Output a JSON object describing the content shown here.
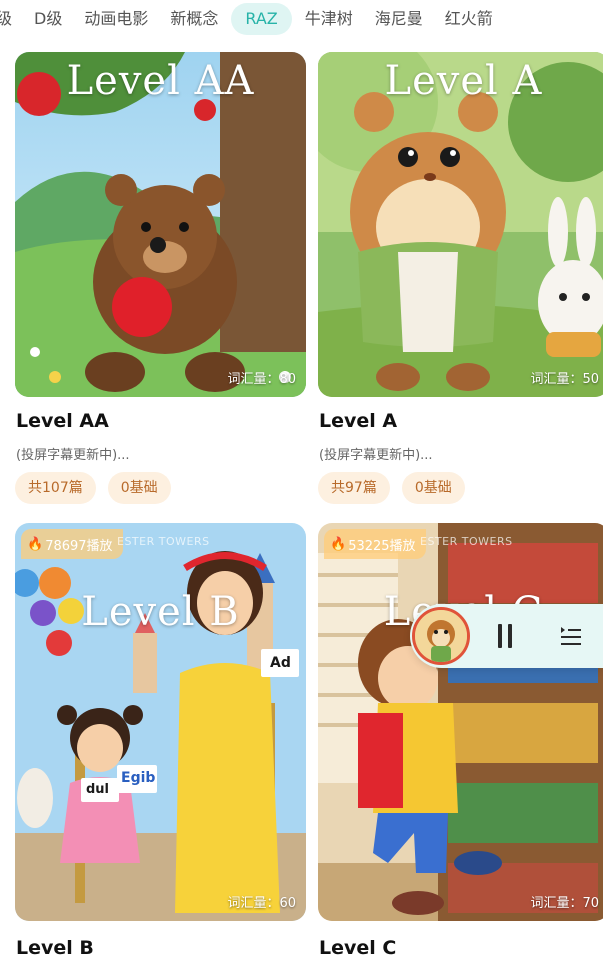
{
  "tabs": [
    {
      "label": "级",
      "active": false
    },
    {
      "label": "D级",
      "active": false
    },
    {
      "label": "动画电影",
      "active": false
    },
    {
      "label": "新概念",
      "active": false
    },
    {
      "label": "RAZ",
      "active": true
    },
    {
      "label": "牛津树",
      "active": false
    },
    {
      "label": "海尼曼",
      "active": false
    },
    {
      "label": "红火箭",
      "active": false
    }
  ],
  "cards": [
    {
      "cover_title": "Level  AA",
      "title": "Level  AA",
      "subtitle": "(投屏字幕更新中)...",
      "vocab": "词汇量：80",
      "tags": [
        "共107篇",
        "0基础"
      ]
    },
    {
      "cover_title": "Level  A",
      "title": "Level A",
      "subtitle": "(投屏字幕更新中)...",
      "vocab": "词汇量：50",
      "tags": [
        "共97篇",
        "0基础"
      ]
    },
    {
      "cover_title": "Level  B",
      "title": "Level B",
      "vocab": "词汇量：60",
      "plays": "78697播放",
      "ghost": "ESTER TOWERS",
      "sign_text": "Ad",
      "card_texts": [
        "dul",
        "Egib"
      ]
    },
    {
      "cover_title": "Level  C",
      "title": "Level C",
      "vocab": "词汇量：70",
      "plays": "53225播放",
      "ghost": "ESTER TOWERS"
    }
  ],
  "colors": {
    "accent": "#27b3a8",
    "tag_bg": "#fdf0e0",
    "tag_text": "#b86a2a"
  }
}
